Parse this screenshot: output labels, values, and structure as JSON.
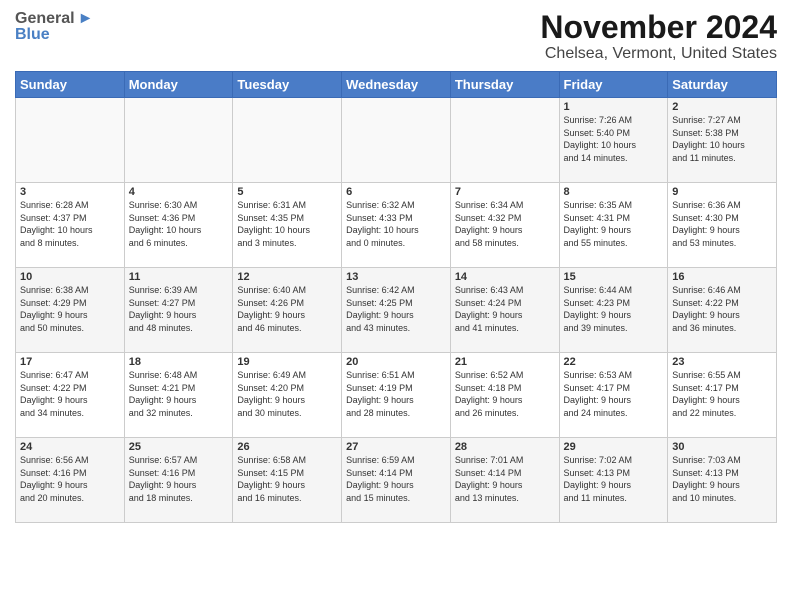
{
  "header": {
    "logo": {
      "general": "General",
      "blue": "Blue"
    },
    "title": "November 2024",
    "subtitle": "Chelsea, Vermont, United States"
  },
  "calendar": {
    "headers": [
      "Sunday",
      "Monday",
      "Tuesday",
      "Wednesday",
      "Thursday",
      "Friday",
      "Saturday"
    ],
    "rows": [
      {
        "cells": [
          {
            "day": "",
            "info": ""
          },
          {
            "day": "",
            "info": ""
          },
          {
            "day": "",
            "info": ""
          },
          {
            "day": "",
            "info": ""
          },
          {
            "day": "",
            "info": ""
          },
          {
            "day": "1",
            "info": "Sunrise: 7:26 AM\nSunset: 5:40 PM\nDaylight: 10 hours\nand 14 minutes."
          },
          {
            "day": "2",
            "info": "Sunrise: 7:27 AM\nSunset: 5:38 PM\nDaylight: 10 hours\nand 11 minutes."
          }
        ]
      },
      {
        "cells": [
          {
            "day": "3",
            "info": "Sunrise: 6:28 AM\nSunset: 4:37 PM\nDaylight: 10 hours\nand 8 minutes."
          },
          {
            "day": "4",
            "info": "Sunrise: 6:30 AM\nSunset: 4:36 PM\nDaylight: 10 hours\nand 6 minutes."
          },
          {
            "day": "5",
            "info": "Sunrise: 6:31 AM\nSunset: 4:35 PM\nDaylight: 10 hours\nand 3 minutes."
          },
          {
            "day": "6",
            "info": "Sunrise: 6:32 AM\nSunset: 4:33 PM\nDaylight: 10 hours\nand 0 minutes."
          },
          {
            "day": "7",
            "info": "Sunrise: 6:34 AM\nSunset: 4:32 PM\nDaylight: 9 hours\nand 58 minutes."
          },
          {
            "day": "8",
            "info": "Sunrise: 6:35 AM\nSunset: 4:31 PM\nDaylight: 9 hours\nand 55 minutes."
          },
          {
            "day": "9",
            "info": "Sunrise: 6:36 AM\nSunset: 4:30 PM\nDaylight: 9 hours\nand 53 minutes."
          }
        ]
      },
      {
        "cells": [
          {
            "day": "10",
            "info": "Sunrise: 6:38 AM\nSunset: 4:29 PM\nDaylight: 9 hours\nand 50 minutes."
          },
          {
            "day": "11",
            "info": "Sunrise: 6:39 AM\nSunset: 4:27 PM\nDaylight: 9 hours\nand 48 minutes."
          },
          {
            "day": "12",
            "info": "Sunrise: 6:40 AM\nSunset: 4:26 PM\nDaylight: 9 hours\nand 46 minutes."
          },
          {
            "day": "13",
            "info": "Sunrise: 6:42 AM\nSunset: 4:25 PM\nDaylight: 9 hours\nand 43 minutes."
          },
          {
            "day": "14",
            "info": "Sunrise: 6:43 AM\nSunset: 4:24 PM\nDaylight: 9 hours\nand 41 minutes."
          },
          {
            "day": "15",
            "info": "Sunrise: 6:44 AM\nSunset: 4:23 PM\nDaylight: 9 hours\nand 39 minutes."
          },
          {
            "day": "16",
            "info": "Sunrise: 6:46 AM\nSunset: 4:22 PM\nDaylight: 9 hours\nand 36 minutes."
          }
        ]
      },
      {
        "cells": [
          {
            "day": "17",
            "info": "Sunrise: 6:47 AM\nSunset: 4:22 PM\nDaylight: 9 hours\nand 34 minutes."
          },
          {
            "day": "18",
            "info": "Sunrise: 6:48 AM\nSunset: 4:21 PM\nDaylight: 9 hours\nand 32 minutes."
          },
          {
            "day": "19",
            "info": "Sunrise: 6:49 AM\nSunset: 4:20 PM\nDaylight: 9 hours\nand 30 minutes."
          },
          {
            "day": "20",
            "info": "Sunrise: 6:51 AM\nSunset: 4:19 PM\nDaylight: 9 hours\nand 28 minutes."
          },
          {
            "day": "21",
            "info": "Sunrise: 6:52 AM\nSunset: 4:18 PM\nDaylight: 9 hours\nand 26 minutes."
          },
          {
            "day": "22",
            "info": "Sunrise: 6:53 AM\nSunset: 4:17 PM\nDaylight: 9 hours\nand 24 minutes."
          },
          {
            "day": "23",
            "info": "Sunrise: 6:55 AM\nSunset: 4:17 PM\nDaylight: 9 hours\nand 22 minutes."
          }
        ]
      },
      {
        "cells": [
          {
            "day": "24",
            "info": "Sunrise: 6:56 AM\nSunset: 4:16 PM\nDaylight: 9 hours\nand 20 minutes."
          },
          {
            "day": "25",
            "info": "Sunrise: 6:57 AM\nSunset: 4:16 PM\nDaylight: 9 hours\nand 18 minutes."
          },
          {
            "day": "26",
            "info": "Sunrise: 6:58 AM\nSunset: 4:15 PM\nDaylight: 9 hours\nand 16 minutes."
          },
          {
            "day": "27",
            "info": "Sunrise: 6:59 AM\nSunset: 4:14 PM\nDaylight: 9 hours\nand 15 minutes."
          },
          {
            "day": "28",
            "info": "Sunrise: 7:01 AM\nSunset: 4:14 PM\nDaylight: 9 hours\nand 13 minutes."
          },
          {
            "day": "29",
            "info": "Sunrise: 7:02 AM\nSunset: 4:13 PM\nDaylight: 9 hours\nand 11 minutes."
          },
          {
            "day": "30",
            "info": "Sunrise: 7:03 AM\nSunset: 4:13 PM\nDaylight: 9 hours\nand 10 minutes."
          }
        ]
      }
    ]
  }
}
